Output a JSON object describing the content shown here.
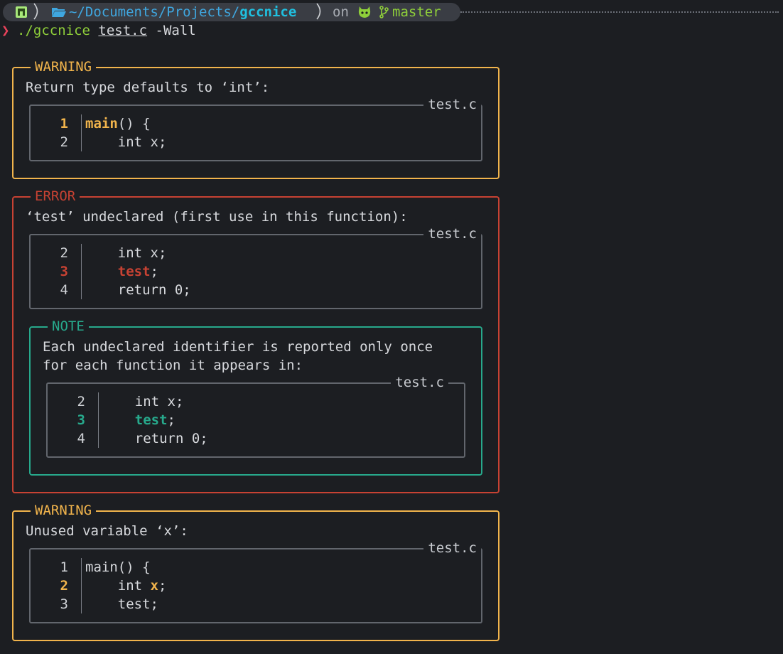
{
  "prompt": {
    "path_prefix": "~/Documents/Projects/",
    "path_dir": "gccnice",
    "on_label": "on",
    "branch": "master",
    "chevron": "❯",
    "command": "./gccnice",
    "arg_file": "test.c",
    "arg_flag": "-Wall"
  },
  "colors": {
    "warning": "#f1b44c",
    "error": "#c74233",
    "note": "#27a98c",
    "path": "#3fa7e0",
    "branch": "#8fcf3a"
  },
  "diagnostics": [
    {
      "level": "WARNING",
      "message": "Return type defaults to ‘int’:",
      "file": "test.c",
      "lines": [
        {
          "num": "1",
          "code_pre": "",
          "code_hl": "main",
          "code_post": "() {"
        },
        {
          "num": "2",
          "code_pre": "    int x;",
          "code_hl": "",
          "code_post": ""
        }
      ]
    },
    {
      "level": "ERROR",
      "message": "‘test’ undeclared (first use in this function):",
      "file": "test.c",
      "lines": [
        {
          "num": "2",
          "code_pre": "    int x;",
          "code_hl": "",
          "code_post": ""
        },
        {
          "num": "3",
          "code_pre": "    ",
          "code_hl": "test",
          "code_post": ";"
        },
        {
          "num": "4",
          "code_pre": "    return 0;",
          "code_hl": "",
          "code_post": ""
        }
      ],
      "note": {
        "level": "NOTE",
        "message_line1": "Each undeclared identifier is reported only once",
        "message_line2": "for each function it appears in:",
        "file": "test.c",
        "lines": [
          {
            "num": "2",
            "code_pre": "    int x;",
            "code_hl": "",
            "code_post": ""
          },
          {
            "num": "3",
            "code_pre": "    ",
            "code_hl": "test",
            "code_post": ";"
          },
          {
            "num": "4",
            "code_pre": "    return 0;",
            "code_hl": "",
            "code_post": ""
          }
        ]
      }
    },
    {
      "level": "WARNING",
      "message": "Unused variable ‘x’:",
      "file": "test.c",
      "lines": [
        {
          "num": "1",
          "code_pre": "main() {",
          "code_hl": "",
          "code_post": ""
        },
        {
          "num": "2",
          "code_pre": "    int ",
          "code_hl": "x",
          "code_post": ";"
        },
        {
          "num": "3",
          "code_pre": "    test;",
          "code_hl": "",
          "code_post": ""
        }
      ]
    }
  ]
}
